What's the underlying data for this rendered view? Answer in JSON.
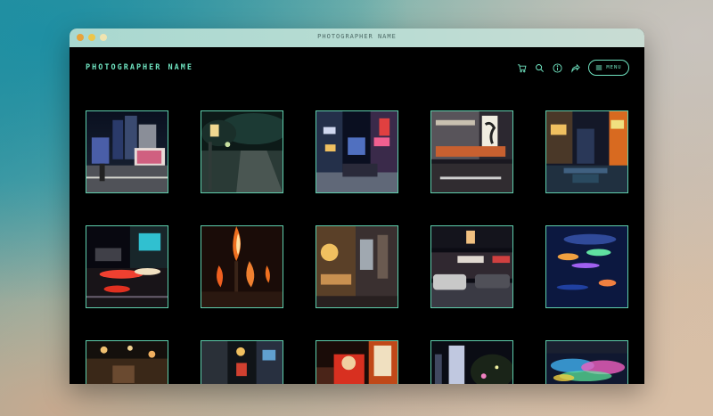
{
  "window": {
    "title": "PHOTOGRAPHER NAME"
  },
  "header": {
    "brand": "PHOTOGRAPHER NAME",
    "menu_label": "MENU",
    "icons": [
      "cart-icon",
      "search-icon",
      "info-icon",
      "share-icon",
      "hamburger-icon"
    ]
  },
  "colors": {
    "accent": "#6fe3c0",
    "page_background": "#000000"
  },
  "gallery": {
    "rows": 3,
    "columns": 5,
    "photos": [
      {
        "name": "photo-city-street-night"
      },
      {
        "name": "photo-park-path-night"
      },
      {
        "name": "photo-neon-street-crowd"
      },
      {
        "name": "photo-shopfronts-crossing"
      },
      {
        "name": "photo-canal-neon-signs"
      },
      {
        "name": "photo-traffic-light-trails"
      },
      {
        "name": "photo-fire-torches"
      },
      {
        "name": "photo-lit-building-corner"
      },
      {
        "name": "photo-parked-cars-street"
      },
      {
        "name": "photo-colorful-lights-water"
      },
      {
        "name": "photo-night-market-stalls"
      },
      {
        "name": "photo-narrow-alley-lanterns"
      },
      {
        "name": "photo-festival-float"
      },
      {
        "name": "photo-lit-tower-trees"
      },
      {
        "name": "photo-light-installation-floor"
      }
    ]
  }
}
